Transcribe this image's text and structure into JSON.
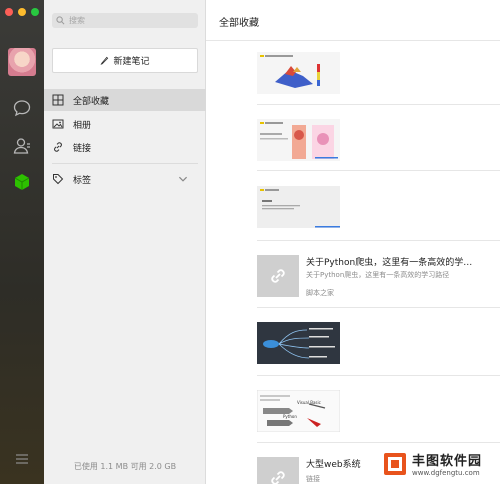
{
  "sidebar": {
    "search_placeholder": "搜索",
    "new_note_label": "新建笔记",
    "items": [
      {
        "label": "全部收藏",
        "icon": "grid-icon"
      },
      {
        "label": "相册",
        "icon": "photo-icon"
      },
      {
        "label": "链接",
        "icon": "link-icon"
      },
      {
        "label": "标签",
        "icon": "tag-icon"
      }
    ],
    "storage": "已使用 1.1 MB 可用 2.0 GB"
  },
  "main": {
    "title": "全部收藏",
    "items": [
      {
        "type": "image"
      },
      {
        "type": "image"
      },
      {
        "type": "image"
      },
      {
        "type": "link",
        "title": "关于Python爬虫，这里有一条高效的学…",
        "subtitle": "关于Python爬虫，这里有一条高效的学习路径",
        "source": "脚本之家"
      },
      {
        "type": "image"
      },
      {
        "type": "image",
        "labels": [
          "Visual Basic",
          "Python"
        ]
      },
      {
        "type": "link",
        "title": "大型web系统",
        "subtitle": "",
        "source": "链接"
      }
    ]
  },
  "watermark": {
    "name": "丰图软件园",
    "url": "www.dgfengtu.com"
  },
  "colors": {
    "rail": "#2e2d27",
    "sidebar": "#f0f0f0",
    "active": "#d9d9d9",
    "accent_green": "#2dc100",
    "watermark": "#e8531c"
  }
}
